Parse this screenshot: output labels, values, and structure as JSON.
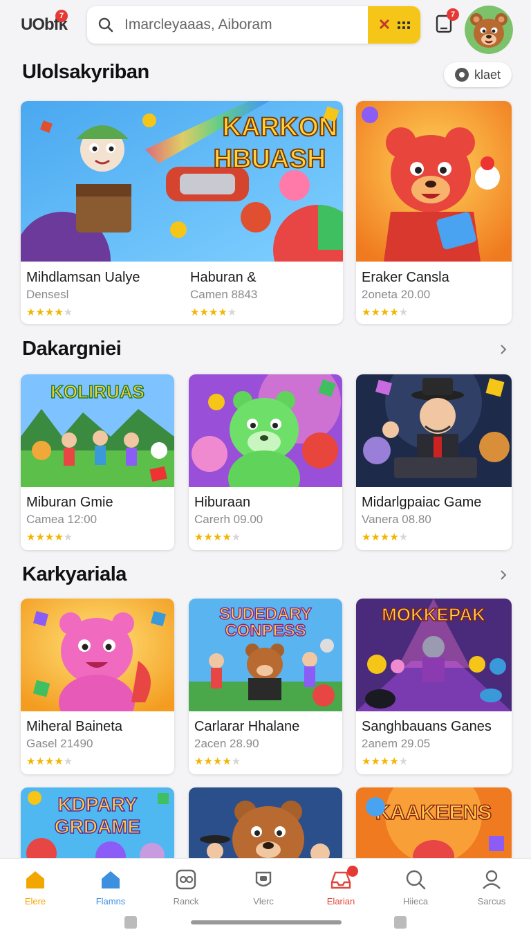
{
  "header": {
    "logo_text": "UObfk",
    "logo_badge": "7",
    "search_placeholder": "Imarcleyaaas, Aiboram",
    "notification_badge": "7",
    "avatar_icon": "bear-avatar"
  },
  "sections": [
    {
      "title": "Ulolsakyriban",
      "action_label": "klaet",
      "cards": [
        {
          "title": "Mihdlamsan Ualye",
          "subtitle": "Densesl",
          "rating": 4
        },
        {
          "title": "Haburan &",
          "subtitle": "Camen 8843",
          "rating": 4
        },
        {
          "title": "Eraker Cansla",
          "subtitle": "2oneta 20.00",
          "rating": 4
        }
      ],
      "banner_text": [
        "KARKON",
        "HBUASH"
      ]
    },
    {
      "title": "Dakargniei",
      "cards": [
        {
          "title": "Miburan Gmie",
          "subtitle": "Camea 12:00",
          "rating": 4,
          "thumb_text": "KOLIRUAS"
        },
        {
          "title": "Hiburaan",
          "subtitle": "Carerh 09.00",
          "rating": 4
        },
        {
          "title": "Midarlgpaiac Game",
          "subtitle": "Vanera 08.80",
          "rating": 4
        }
      ]
    },
    {
      "title": "Karkyariala",
      "cards": [
        {
          "title": "Miheral Baineta",
          "subtitle": "Gasel 21490",
          "rating": 4
        },
        {
          "title": "Carlarar Hhalane",
          "subtitle": "2acen 28.90",
          "rating": 4,
          "thumb_text": [
            "SUDEDARY",
            "CONPESS"
          ]
        },
        {
          "title": "Sanghbauans Ganes",
          "subtitle": "2anem 29.05",
          "rating": 4,
          "thumb_text": "MOKKEPAK"
        }
      ]
    },
    {
      "cards": [
        {
          "thumb_text": [
            "KDPARY",
            "GRDAME"
          ]
        },
        {},
        {
          "thumb_text": "KAAKEENS"
        }
      ]
    }
  ],
  "bottom_nav": [
    {
      "label": "Elere",
      "icon": "home-icon",
      "active": true
    },
    {
      "label": "Flamns",
      "icon": "house-icon"
    },
    {
      "label": "Ranck",
      "icon": "gamepad-icon"
    },
    {
      "label": "Vlerc",
      "icon": "mask-icon"
    },
    {
      "label": "Elarian",
      "icon": "inbox-icon"
    },
    {
      "label": "Hiieca",
      "icon": "search-icon"
    },
    {
      "label": "Sarcus",
      "icon": "profile-icon"
    }
  ],
  "colors": {
    "accent_yellow": "#f5c518",
    "badge_red": "#e53935",
    "star": "#f2b600",
    "nav_active_home": "#f2a600",
    "nav_blue": "#3d8fe0",
    "nav_red": "#e0463a"
  }
}
